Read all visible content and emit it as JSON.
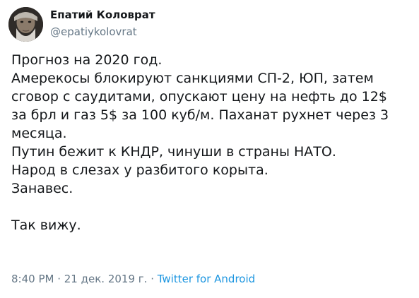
{
  "author": {
    "name": "Епатий Коловрат",
    "handle": "@epatiykolovrat"
  },
  "tweet": {
    "lines": [
      "Прогноз на 2020 год.",
      "Амерекосы блокируют санкциями СП-2, ЮП, затем",
      "сговор с саудитами, опускают цену на нефть до 12$",
      "за брл и газ 5$ за 100 куб/м. Паханат рухнет через 3",
      "месяца.",
      "Путин бежит к КНДР, чинуши в страны НАТО.",
      "Народ в слезах у разбитого корыта.",
      "Занавес.",
      "",
      "Так вижу."
    ]
  },
  "meta": {
    "time": "8:40 PM",
    "separator1": " · ",
    "date": "21 дек. 2019 г.",
    "separator2": " · ",
    "source": "Twitter for Android"
  },
  "colors": {
    "text": "#14171a",
    "secondary": "#657786",
    "link": "#1b95e0"
  }
}
